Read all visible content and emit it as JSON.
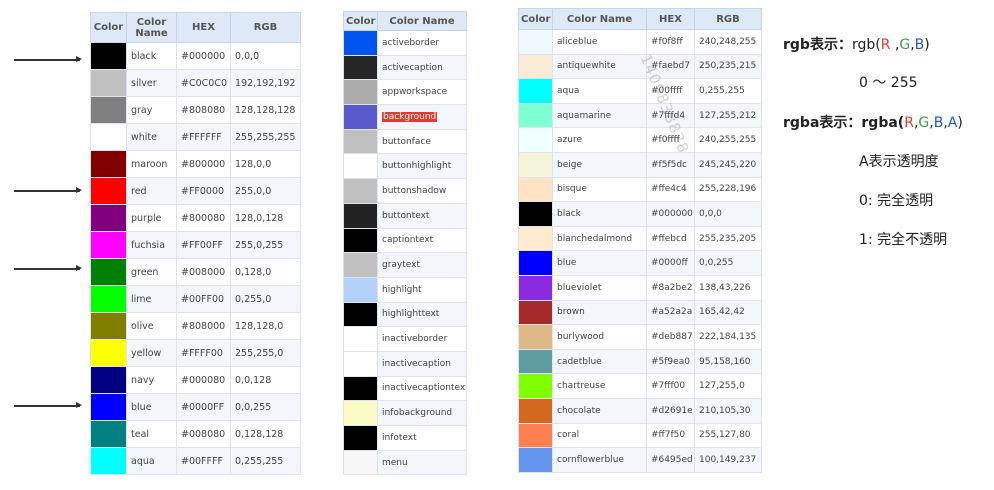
{
  "table1": {
    "headers": [
      "Color",
      "Color Name",
      "HEX",
      "RGB"
    ],
    "rows": [
      {
        "name": "black",
        "hex": "#000000",
        "rgb": "0,0,0",
        "swatch": "#000000"
      },
      {
        "name": "silver",
        "hex": "#C0C0C0",
        "rgb": "192,192,192",
        "swatch": "#c0c0c0"
      },
      {
        "name": "gray",
        "hex": "#808080",
        "rgb": "128,128,128",
        "swatch": "#808080"
      },
      {
        "name": "white",
        "hex": "#FFFFFF",
        "rgb": "255,255,255",
        "swatch": "#ffffff"
      },
      {
        "name": "maroon",
        "hex": "#800000",
        "rgb": "128,0,0",
        "swatch": "#800000"
      },
      {
        "name": "red",
        "hex": "#FF0000",
        "rgb": "255,0,0",
        "swatch": "#ff0000"
      },
      {
        "name": "purple",
        "hex": "#800080",
        "rgb": "128,0,128",
        "swatch": "#800080"
      },
      {
        "name": "fuchsia",
        "hex": "#FF00FF",
        "rgb": "255,0,255",
        "swatch": "#ff00ff"
      },
      {
        "name": "green",
        "hex": "#008000",
        "rgb": "0,128,0",
        "swatch": "#008000"
      },
      {
        "name": "lime",
        "hex": "#00FF00",
        "rgb": "0,255,0",
        "swatch": "#00ff00"
      },
      {
        "name": "olive",
        "hex": "#808000",
        "rgb": "128,128,0",
        "swatch": "#808000"
      },
      {
        "name": "yellow",
        "hex": "#FFFF00",
        "rgb": "255,255,0",
        "swatch": "#ffff00"
      },
      {
        "name": "navy",
        "hex": "#000080",
        "rgb": "0,0,128",
        "swatch": "#000080"
      },
      {
        "name": "blue",
        "hex": "#0000FF",
        "rgb": "0,0,255",
        "swatch": "#0000ff"
      },
      {
        "name": "teal",
        "hex": "#008080",
        "rgb": "0,128,128",
        "swatch": "#008080"
      },
      {
        "name": "aqua",
        "hex": "#00FFFF",
        "rgb": "0,255,255",
        "swatch": "#00ffff"
      }
    ]
  },
  "table2": {
    "headers": [
      "Color",
      "Color Name"
    ],
    "rows": [
      {
        "name": "activeborder",
        "swatch": "#0055ee"
      },
      {
        "name": "activecaption",
        "swatch": "#262626"
      },
      {
        "name": "appworkspace",
        "swatch": "#ababab"
      },
      {
        "name": "background",
        "swatch": "#5a5acd",
        "highlighted": true
      },
      {
        "name": "buttonface",
        "swatch": "#c0c0c0"
      },
      {
        "name": "buttonhighlight",
        "swatch": "#ffffff"
      },
      {
        "name": "buttonshadow",
        "swatch": "#c0c0c0"
      },
      {
        "name": "buttontext",
        "swatch": "#222222"
      },
      {
        "name": "captiontext",
        "swatch": "#000000"
      },
      {
        "name": "graytext",
        "swatch": "#c0c0c0"
      },
      {
        "name": "highlight",
        "swatch": "#b2d0fa"
      },
      {
        "name": "highlighttext",
        "swatch": "#000000"
      },
      {
        "name": "inactiveborder",
        "swatch": "#ffffff"
      },
      {
        "name": "inactivecaption",
        "swatch": "#ffffff"
      },
      {
        "name": "inactivecaptiontext",
        "swatch": "#000000"
      },
      {
        "name": "infobackground",
        "swatch": "#fbfcc5"
      },
      {
        "name": "infotext",
        "swatch": "#000000"
      },
      {
        "name": "menu",
        "swatch": "#f7f7f7"
      }
    ]
  },
  "table3": {
    "headers": [
      "Color",
      "Color Name",
      "HEX",
      "RGB"
    ],
    "rows": [
      {
        "name": "aliceblue",
        "hex": "#f0f8ff",
        "rgb": "240,248,255",
        "swatch": "#f0f8ff"
      },
      {
        "name": "antiquewhite",
        "hex": "#faebd7",
        "rgb": "250,235,215",
        "swatch": "#faebd7"
      },
      {
        "name": "aqua",
        "hex": "#00ffff",
        "rgb": "0,255,255",
        "swatch": "#00ffff"
      },
      {
        "name": "aquamarine",
        "hex": "#7fffd4",
        "rgb": "127,255,212",
        "swatch": "#7fffd4"
      },
      {
        "name": "azure",
        "hex": "#f0ffff",
        "rgb": "240,255,255",
        "swatch": "#f0ffff"
      },
      {
        "name": "beige",
        "hex": "#f5f5dc",
        "rgb": "245,245,220",
        "swatch": "#f5f5dc"
      },
      {
        "name": "bisque",
        "hex": "#ffe4c4",
        "rgb": "255,228,196",
        "swatch": "#ffe4c4"
      },
      {
        "name": "black",
        "hex": "#000000",
        "rgb": "0,0,0",
        "swatch": "#000000"
      },
      {
        "name": "blanchedalmond",
        "hex": "#ffebcd",
        "rgb": "255,235,205",
        "swatch": "#ffebcd"
      },
      {
        "name": "blue",
        "hex": "#0000ff",
        "rgb": "0,0,255",
        "swatch": "#0000ff"
      },
      {
        "name": "blueviolet",
        "hex": "#8a2be2",
        "rgb": "138,43,226",
        "swatch": "#8a2be2"
      },
      {
        "name": "brown",
        "hex": "#a52a2a",
        "rgb": "165,42,42",
        "swatch": "#a52a2a"
      },
      {
        "name": "burlywood",
        "hex": "#deb887",
        "rgb": "222,184,135",
        "swatch": "#deb887"
      },
      {
        "name": "cadetblue",
        "hex": "#5f9ea0",
        "rgb": "95,158,160",
        "swatch": "#5f9ea0"
      },
      {
        "name": "chartreuse",
        "hex": "#7fff00",
        "rgb": "127,255,0",
        "swatch": "#7fff00"
      },
      {
        "name": "chocolate",
        "hex": "#d2691e",
        "rgb": "210,105,30",
        "swatch": "#d2691e"
      },
      {
        "name": "coral",
        "hex": "#ff7f50",
        "rgb": "255,127,80",
        "swatch": "#ff7f50"
      },
      {
        "name": "cornflowerblue",
        "hex": "#6495ed",
        "rgb": "100,149,237",
        "swatch": "#6495ed"
      }
    ]
  },
  "notes": {
    "rgb_label": "rgb表示：",
    "rgb_prefix": "rgb(",
    "r": "R",
    "g": "G",
    "b": "B",
    "a": "A",
    "comma": " ,",
    "comma_tight": ",",
    "close": ")",
    "range": "0 ～ 255",
    "rgba_label": "rgba表示：",
    "rgba_prefix": "rgba(",
    "alpha_desc": "A表示透明度",
    "transparent": "0: 完全透明",
    "opaque": "1: 完全不透明"
  },
  "watermark": "1409838828"
}
